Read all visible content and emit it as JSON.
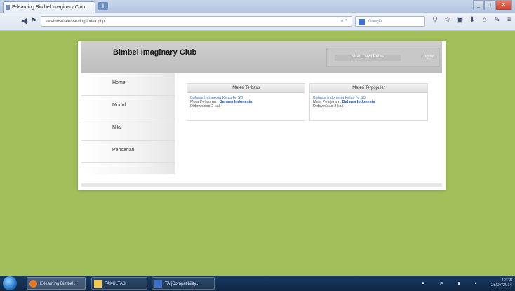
{
  "browser": {
    "tab_title": "E-learning Bimbel Imaginary Club",
    "new_tab_label": "+",
    "url": "localhost/ta/elearning/index.php",
    "search_placeholder": "Google",
    "window_buttons": [
      "_",
      "□",
      "✕"
    ]
  },
  "header": {
    "site_title": "Bimbel Imaginary Club",
    "user_label": "Kiran Dewi Pritas",
    "logout_label": "Logout"
  },
  "menu": {
    "items": [
      {
        "label": "Home"
      },
      {
        "label": "Modul"
      },
      {
        "label": "Nilai"
      },
      {
        "label": "Pencarian"
      }
    ]
  },
  "boxes": [
    {
      "title": "Materi Terbaru",
      "link": "Bahasa Indonesia Kelas IV SD",
      "subject_label": "Mata Pelajaran :",
      "subject_value": "Bahasa Indonesia",
      "downloads": "Didownload 2 kali"
    },
    {
      "title": "Materi Terpopuler",
      "link": "Bahasa Indonesia Kelas IV SD",
      "subject_label": "Mata Pelajaran :",
      "subject_value": "Bahasa Indonesia",
      "downloads": "Didownload 2 kali"
    }
  ],
  "taskbar": {
    "tasks": [
      "E-learning Bimbel...",
      "FAKULTAS",
      "TA [Compatibility..."
    ],
    "time": "12:38",
    "date": "26/07/2014"
  }
}
